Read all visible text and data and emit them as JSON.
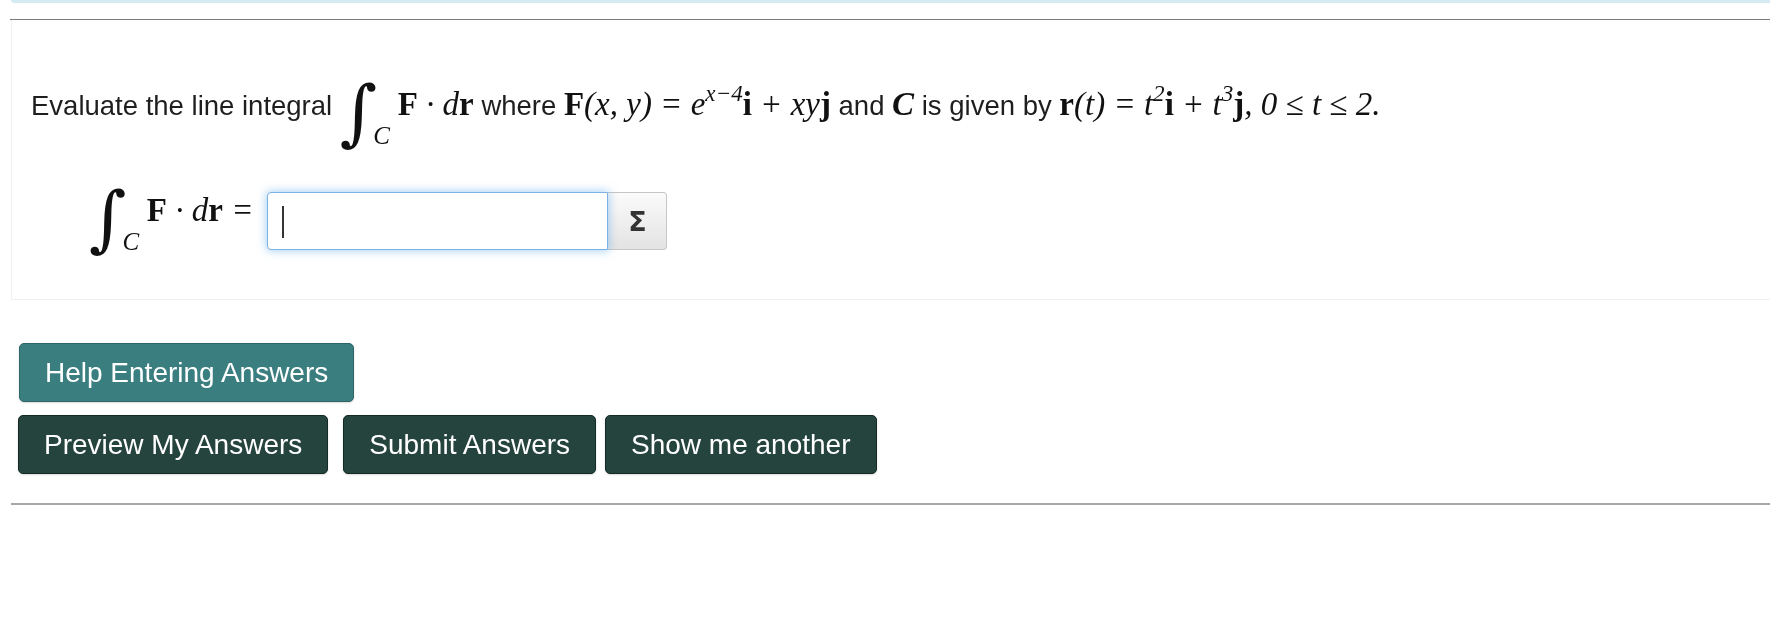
{
  "problem": {
    "statement": [
      {
        "kind": "text",
        "text": "Evaluate the line integral"
      },
      {
        "kind": "integral",
        "sign": "∫",
        "sub": "C"
      },
      {
        "kind": "math",
        "text": "**F** · d**r**"
      },
      {
        "kind": "text",
        "text": "where"
      },
      {
        "kind": "math",
        "text": "**F**(x, y) = e$^{x−4}$**i** + xy**j**"
      },
      {
        "kind": "text",
        "text": "and"
      },
      {
        "kind": "var",
        "text": "C"
      },
      {
        "kind": "text",
        "text": "is given by"
      },
      {
        "kind": "math",
        "text": "**r**(t) = t$^{2}$**i** + t$^{3}$**j**, 0 ≤ t ≤ 2."
      }
    ]
  },
  "answer": {
    "label": [
      {
        "kind": "integral",
        "sign": "∫",
        "sub": "C"
      },
      {
        "kind": "math",
        "text": "**F** · d**r** ="
      }
    ],
    "field": {
      "focused": true
    },
    "button": "Σ"
  },
  "help_button": {
    "label": "Help Entering Answers"
  },
  "action_buttons": [
    {
      "label": "Preview My Answers"
    },
    {
      "label": "Submit Answers"
    },
    {
      "label": "Show me another"
    }
  ]
}
